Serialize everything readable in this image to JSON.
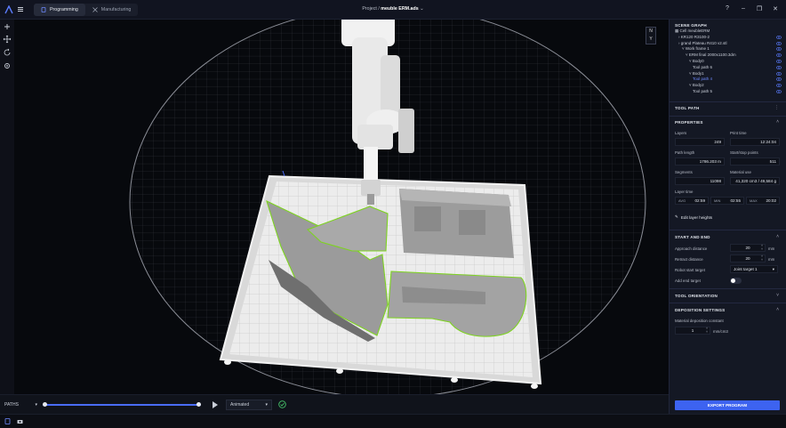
{
  "header": {
    "tabs": [
      {
        "label": "Programming",
        "active": true
      },
      {
        "label": "Manufacturing",
        "active": false
      }
    ],
    "project_prefix": "Project / ",
    "project_name": "meuble ERM.ads",
    "window_controls": [
      "help-icon",
      "minimize-icon",
      "restore-icon",
      "close-icon"
    ]
  },
  "left_tools": [
    "add-icon",
    "move-icon",
    "rotate-icon",
    "settings-icon"
  ],
  "viewport": {
    "compass_labels": [
      "N",
      "Y"
    ],
    "colors": {
      "toolpath_outline": "#7ed321",
      "part_gray": "#8e8e8e",
      "bed": "#e9e9e9",
      "robot": "#f1f1f1"
    }
  },
  "playback": {
    "paths_label": "PATHS",
    "progress": 1.0,
    "mode_label": "Animated"
  },
  "scene_graph": {
    "title": "SCENE GRAPH",
    "items": [
      {
        "label": "Cell meubleERM",
        "depth": 0,
        "icon": "cell-icon",
        "eye": false,
        "selected": false
      },
      {
        "label": "KR120 R3100-2",
        "depth": 1,
        "icon": "chevron-right-icon",
        "eye": true,
        "selected": false
      },
      {
        "label": "grand Plateau R410 v2.stl",
        "depth": 1,
        "icon": "chevron-right-icon",
        "eye": true,
        "selected": false
      },
      {
        "label": "Work frame 1",
        "depth": 2,
        "icon": "chevron-down-icon",
        "eye": true,
        "selected": false
      },
      {
        "label": "ERM final 2000x1100.3dm",
        "depth": 3,
        "icon": "chevron-down-icon",
        "eye": true,
        "selected": false
      },
      {
        "label": "Body0",
        "depth": 4,
        "icon": "chevron-down-icon",
        "eye": true,
        "selected": false
      },
      {
        "label": "Tool path 6",
        "depth": 5,
        "icon": "",
        "eye": true,
        "selected": false
      },
      {
        "label": "Body1",
        "depth": 4,
        "icon": "chevron-down-icon",
        "eye": true,
        "selected": false
      },
      {
        "label": "Tool path 4",
        "depth": 5,
        "icon": "",
        "eye": true,
        "selected": true
      },
      {
        "label": "Body2",
        "depth": 4,
        "icon": "chevron-down-icon",
        "eye": true,
        "selected": false
      },
      {
        "label": "Tool path 5",
        "depth": 5,
        "icon": "",
        "eye": true,
        "selected": false
      }
    ]
  },
  "tool_path": {
    "title": "TOOL PATH"
  },
  "properties": {
    "title": "PROPERTIES",
    "layers_label": "Layers",
    "layers_value": "249",
    "print_time_label": "Print time",
    "print_time_value": "12:24:04",
    "path_length_label": "Path length",
    "path_length_value": "1786.203 m",
    "start_stop_label": "Start/stop points",
    "start_stop_value": "511",
    "segments_label": "Segments",
    "segments_value": "11098",
    "material_label": "Material use",
    "material_value": "41,320 cm3 / 49,584 g",
    "layer_time_label": "Layer time",
    "avg_label": "AVG",
    "avg_value": "02:59",
    "min_label": "MIN",
    "min_value": "02:55",
    "max_label": "MAX",
    "max_value": "20:02",
    "edit_layer_heights": "Edit layer heights"
  },
  "start_end": {
    "title": "START AND END",
    "approach_label": "Approach distance",
    "approach_value": "20",
    "approach_unit": "mm",
    "retract_label": "Retract distance",
    "retract_value": "20",
    "retract_unit": "mm",
    "robot_start_label": "Robot start target",
    "robot_start_value": "Joint target 1",
    "add_end_label": "Add end target",
    "add_end_on": false
  },
  "tool_orientation": {
    "title": "TOOL ORIENTATION"
  },
  "deposition": {
    "title": "DEPOSITION SETTINGS",
    "constant_label": "Material deposition constant",
    "constant_value": "1",
    "constant_unit": "mm/cm3"
  },
  "export_label": "EXPORT PROGRAM"
}
